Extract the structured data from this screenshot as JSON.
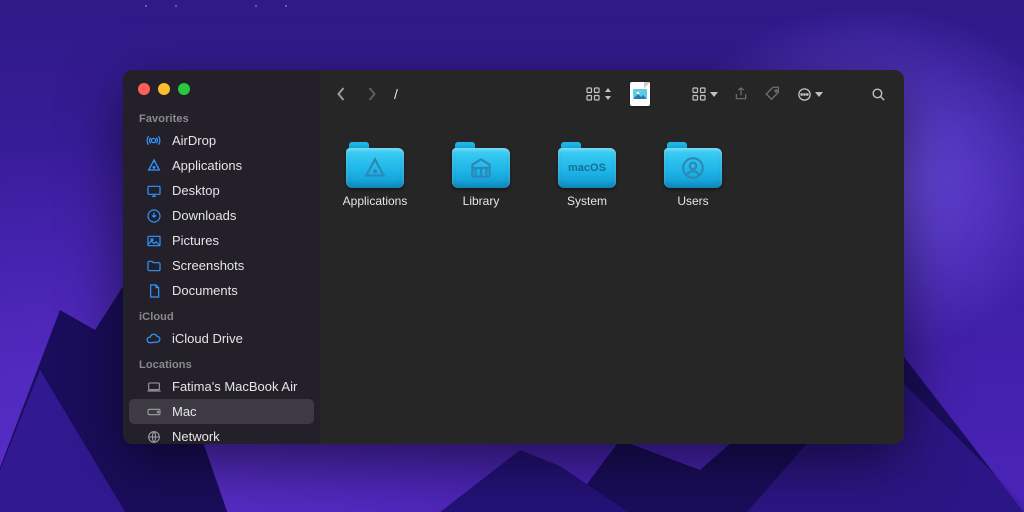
{
  "path_title": "/",
  "sidebar": {
    "sections": [
      {
        "title": "Favorites",
        "items": [
          {
            "label": "AirDrop",
            "icon": "airdrop"
          },
          {
            "label": "Applications",
            "icon": "apps"
          },
          {
            "label": "Desktop",
            "icon": "desktop"
          },
          {
            "label": "Downloads",
            "icon": "downloads"
          },
          {
            "label": "Pictures",
            "icon": "pictures"
          },
          {
            "label": "Screenshots",
            "icon": "folder"
          },
          {
            "label": "Documents",
            "icon": "documents"
          }
        ]
      },
      {
        "title": "iCloud",
        "items": [
          {
            "label": "iCloud Drive",
            "icon": "cloud"
          }
        ]
      },
      {
        "title": "Locations",
        "items": [
          {
            "label": "Fatima's MacBook Air",
            "icon": "laptop"
          },
          {
            "label": "Mac",
            "icon": "disk",
            "active": true
          },
          {
            "label": "Network",
            "icon": "globe"
          }
        ]
      }
    ]
  },
  "folders": [
    {
      "label": "Applications",
      "glyph": "apps"
    },
    {
      "label": "Library",
      "glyph": "library"
    },
    {
      "label": "System",
      "glyph": "macos"
    },
    {
      "label": "Users",
      "glyph": "user"
    }
  ]
}
